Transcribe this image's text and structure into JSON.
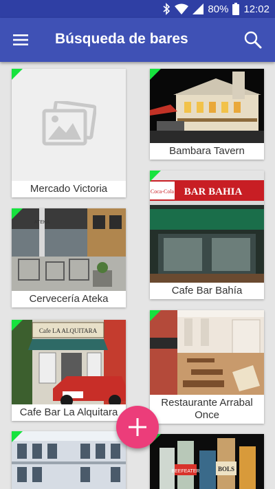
{
  "status_bar": {
    "battery": "80%",
    "time": "12:02",
    "icons": [
      "bluetooth-icon",
      "wifi-icon",
      "signal-icon",
      "battery-icon"
    ]
  },
  "app_bar": {
    "title": "Búsqueda de bares",
    "menu_icon": "menu-icon",
    "search_icon": "search-icon"
  },
  "bars": [
    {
      "name": "Mercado Victoria",
      "image": "placeholder-image-icon"
    },
    {
      "name": "Bambara Tavern",
      "image": "night-building-photo"
    },
    {
      "name": "Cervecería Ateka",
      "image": "terrace-photo"
    },
    {
      "name": "Cafe Bar Bahía",
      "image": "storefront-photo"
    },
    {
      "name": "Cafe Bar La Alquitara",
      "image": "storefront-photo"
    },
    {
      "name": "Restaurante Arrabal Once",
      "image": "dining-room-photo"
    },
    {
      "name": "",
      "image": "building-photo"
    },
    {
      "name": "",
      "image": "bottles-photo"
    }
  ],
  "signs": {
    "bahia": "BAR BAHIA",
    "cocacola": "Coca-Cola",
    "alquitara": "Cafe LA ALQUITARA",
    "ateka": "ATEKA",
    "beefeater": "BEEFEATER",
    "bols": "BOLS"
  },
  "fab": {
    "icon": "plus-icon"
  },
  "colors": {
    "primary": "#3f51b5",
    "primary_dark": "#2f3fa4",
    "accent": "#ec3d7a",
    "new_corner": "#16e33e"
  }
}
